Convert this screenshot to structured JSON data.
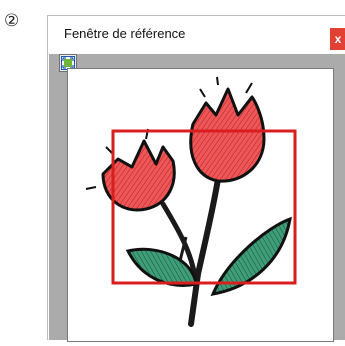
{
  "step": {
    "number": "②"
  },
  "window": {
    "title": "Fenêtre de référence",
    "close_label": "x"
  },
  "toolbar": {
    "fit_icon": "fit-to-window-icon"
  },
  "image": {
    "subject": "embroidered-tulips-icon",
    "colors": {
      "petals": "#e74c4c",
      "leaves": "#2f8f6a",
      "outline": "#111111",
      "selection": "#d81e1e"
    }
  }
}
